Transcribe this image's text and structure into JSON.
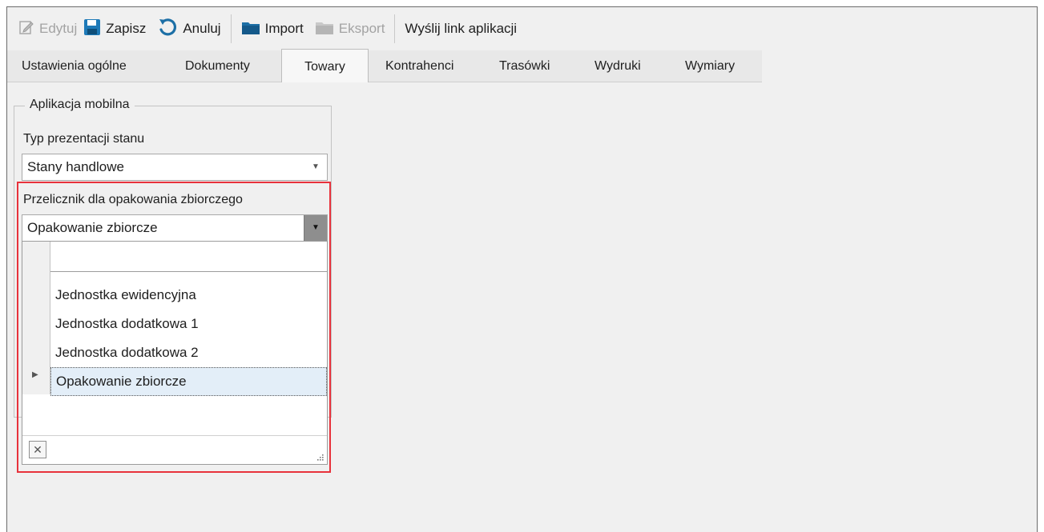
{
  "toolbar": {
    "edit_label": "Edytuj",
    "save_label": "Zapisz",
    "cancel_label": "Anuluj",
    "import_label": "Import",
    "export_label": "Eksport",
    "send_link_label": "Wyślij link aplikacji"
  },
  "tabs": [
    {
      "label": "Ustawienia ogólne"
    },
    {
      "label": "Dokumenty"
    },
    {
      "label": "Towary"
    },
    {
      "label": "Kontrahenci"
    },
    {
      "label": "Trasówki"
    },
    {
      "label": "Wydruki"
    },
    {
      "label": "Wymiary"
    }
  ],
  "active_tab": "Towary",
  "mobile_app": {
    "group_title": "Aplikacja mobilna",
    "stock_type_label": "Typ prezentacji stanu",
    "stock_type_value": "Stany handlowe",
    "converter_label": "Przelicznik dla opakowania zbiorczego",
    "converter_value": "Opakowanie zbiorcze",
    "options": [
      {
        "label": "Jednostka ewidencyjna"
      },
      {
        "label": "Jednostka dodatkowa 1"
      },
      {
        "label": "Jednostka dodatkowa 2"
      },
      {
        "label": "Opakowanie zbiorcze"
      }
    ],
    "selected_option": "Opakowanie zbiorcze"
  },
  "colors": {
    "highlight_border": "#e8323c",
    "save_icon": "#1e7ab8",
    "folder_icon": "#1c6fa6"
  },
  "icons": [
    "edit-icon",
    "save-icon",
    "undo-icon",
    "folder-icon",
    "folder-disabled-icon",
    "clear-icon",
    "resize-grip-icon",
    "row-pointer-icon",
    "chevron-down-icon"
  ]
}
